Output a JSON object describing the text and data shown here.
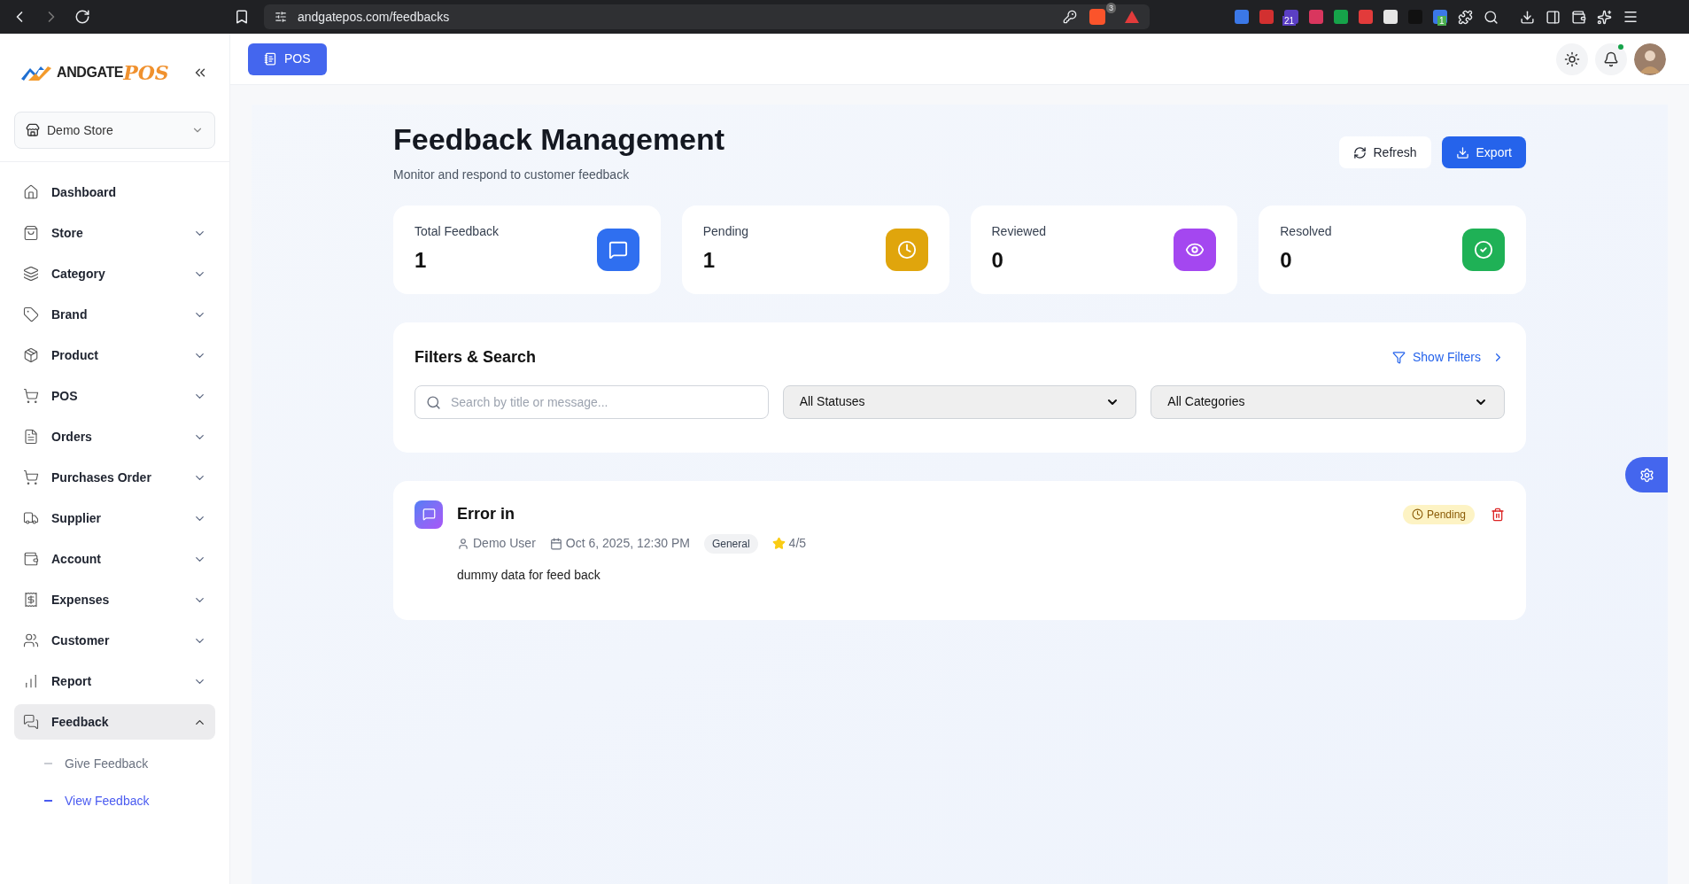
{
  "browser": {
    "url": "andgatepos.com/feedbacks",
    "extension_badges": [
      "3",
      "21",
      "1"
    ]
  },
  "logo": {
    "name": "ANDGATE",
    "accent": "POS"
  },
  "store_selector": {
    "value": "Demo Store"
  },
  "sidebar": {
    "items": [
      {
        "label": "Dashboard",
        "selected": false
      },
      {
        "label": "Store",
        "selected": false,
        "expanded": false
      },
      {
        "label": "Category",
        "selected": false,
        "expanded": false
      },
      {
        "label": "Brand",
        "selected": false,
        "expanded": false
      },
      {
        "label": "Product",
        "selected": false,
        "expanded": false
      },
      {
        "label": "POS",
        "selected": false,
        "expanded": false
      },
      {
        "label": "Orders",
        "selected": false,
        "expanded": false
      },
      {
        "label": "Purchases Order",
        "selected": false,
        "expanded": false
      },
      {
        "label": "Supplier",
        "selected": false,
        "expanded": false
      },
      {
        "label": "Account",
        "selected": false,
        "expanded": false
      },
      {
        "label": "Expenses",
        "selected": false,
        "expanded": false
      },
      {
        "label": "Customer",
        "selected": false,
        "expanded": false
      },
      {
        "label": "Report",
        "selected": false,
        "expanded": false
      },
      {
        "label": "Feedback",
        "selected": true,
        "expanded": true,
        "children": [
          {
            "label": "Give Feedback",
            "selected": false
          },
          {
            "label": "View Feedback",
            "selected": true
          }
        ]
      }
    ]
  },
  "topbar": {
    "pos_button": "POS",
    "notification_dot": true
  },
  "page": {
    "title": "Feedback Management",
    "subtitle": "Monitor and respond to customer feedback",
    "buttons": [
      {
        "label": "Refresh",
        "kind": "secondary"
      },
      {
        "label": "Export",
        "kind": "primary"
      }
    ]
  },
  "stats": [
    {
      "label": "Total Feedback",
      "value": "1",
      "color": "#2f6ff0"
    },
    {
      "label": "Pending",
      "value": "1",
      "color": "#e0a50c"
    },
    {
      "label": "Reviewed",
      "value": "0",
      "color": "#a447f0"
    },
    {
      "label": "Resolved",
      "value": "0",
      "color": "#1fb156"
    }
  ],
  "filters": {
    "title": "Filters & Search",
    "toggle": "Show Filters",
    "search_placeholder": "Search by title or message...",
    "status_select": "All Statuses",
    "category_select": "All Categories"
  },
  "feedback_items": [
    {
      "title": "Error in",
      "user": "Demo User",
      "date": "Oct 6, 2025, 12:30 PM",
      "category": "General",
      "rating": "4/5",
      "message": "dummy data for feed back",
      "status": "Pending"
    }
  ]
}
